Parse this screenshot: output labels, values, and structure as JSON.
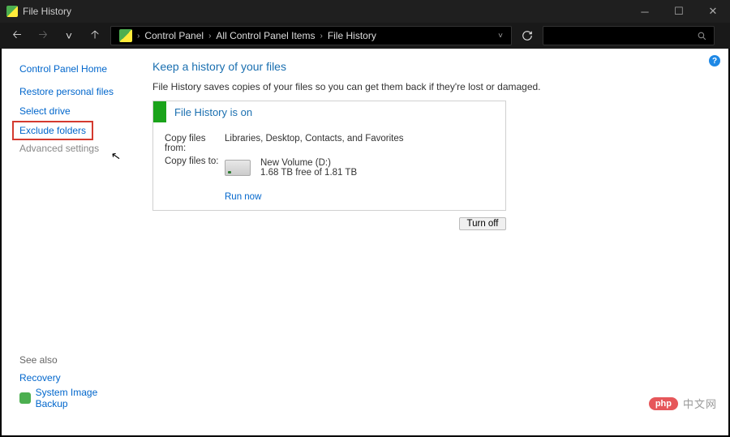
{
  "window": {
    "title": "File History"
  },
  "breadcrumb": {
    "root_sep": "›",
    "items": [
      "Control Panel",
      "All Control Panel Items",
      "File History"
    ]
  },
  "sidebar": {
    "home": "Control Panel Home",
    "links": [
      "Restore personal files",
      "Select drive",
      "Exclude folders",
      "Advanced settings"
    ],
    "see_also": "See also",
    "bottom": [
      "Recovery",
      "System Image Backup"
    ]
  },
  "main": {
    "title": "Keep a history of your files",
    "desc": "File History saves copies of your files so you can get them back if they're lost or damaged.",
    "status_title": "File History is on",
    "copy_from_label": "Copy files from:",
    "copy_from_value": "Libraries, Desktop, Contacts, and Favorites",
    "copy_to_label": "Copy files to:",
    "drive_name": "New Volume (D:)",
    "drive_free": "1.68 TB free of 1.81 TB",
    "run_now": "Run now",
    "turn_off": "Turn off"
  },
  "watermark": {
    "badge": "php",
    "text": "中文网"
  }
}
